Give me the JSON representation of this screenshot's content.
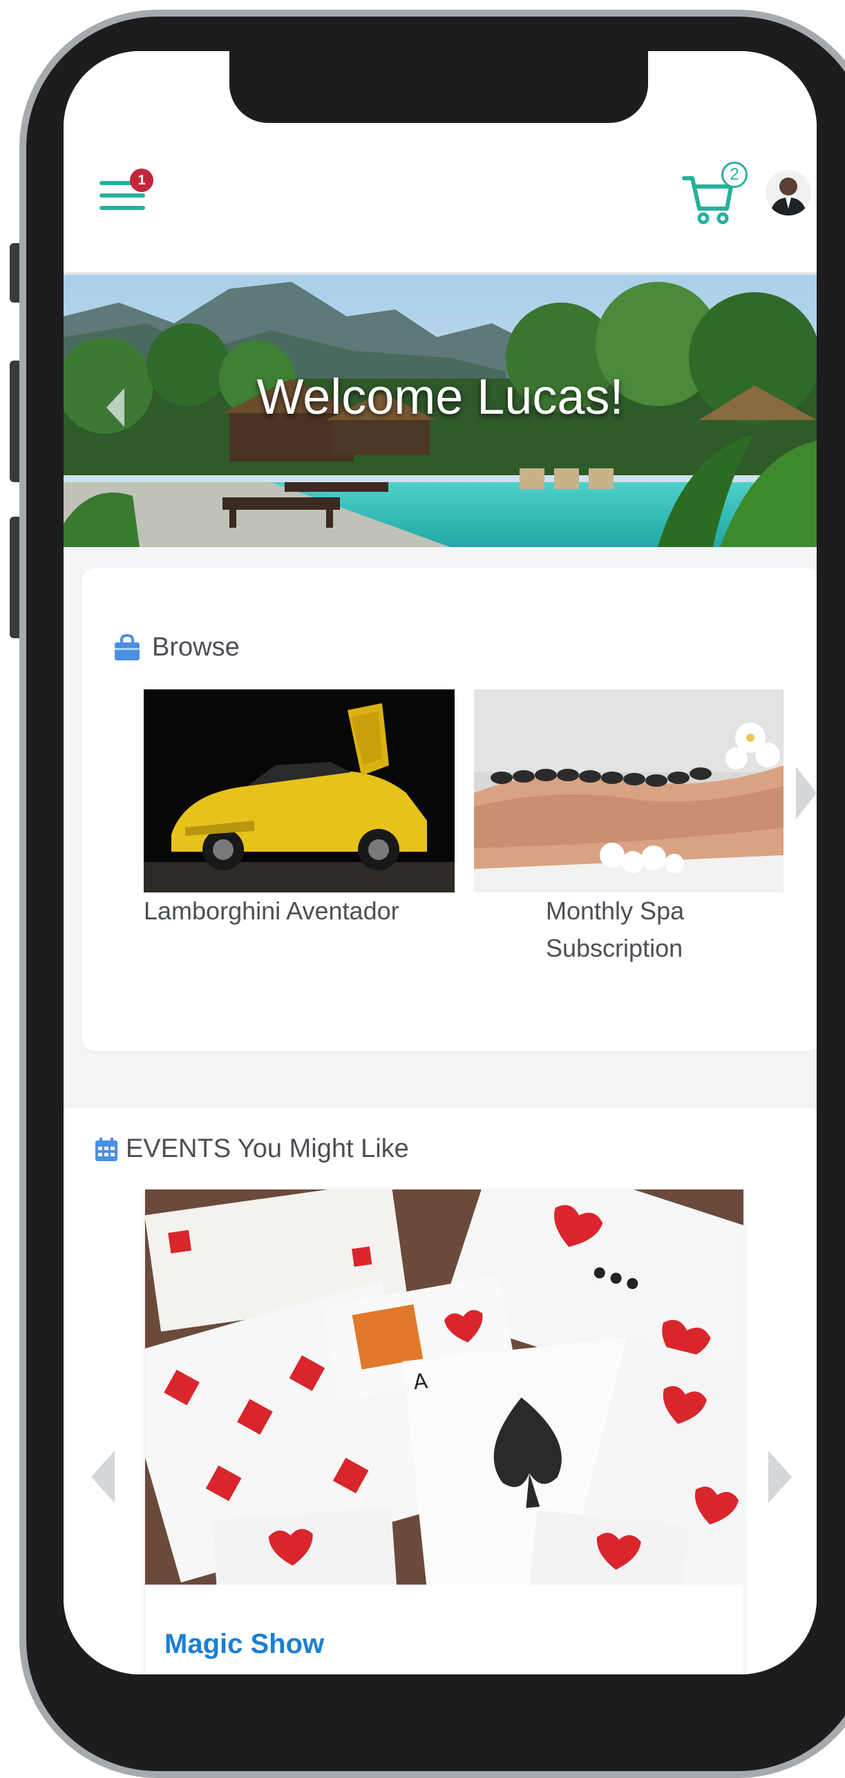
{
  "header": {
    "menu_badge": "1",
    "cart_badge": "2"
  },
  "hero": {
    "title": "Welcome Lucas!"
  },
  "browse": {
    "title": "Browse",
    "items": [
      {
        "label": "Lamborghini Aventador"
      },
      {
        "label_line1": "Monthly Spa",
        "label_line2": "Subscription"
      }
    ]
  },
  "events": {
    "title": "EVENTS You Might Like",
    "items": [
      {
        "title": "Magic Show"
      }
    ]
  },
  "colors": {
    "accent": "#27b09c",
    "badge": "#c3263b",
    "link": "#1a7fd4",
    "icon_blue": "#4a90e2"
  },
  "icons": [
    "menu-icon",
    "cart-icon",
    "shopping-bag-icon",
    "calendar-icon",
    "chevron-left-icon",
    "chevron-right-icon"
  ]
}
